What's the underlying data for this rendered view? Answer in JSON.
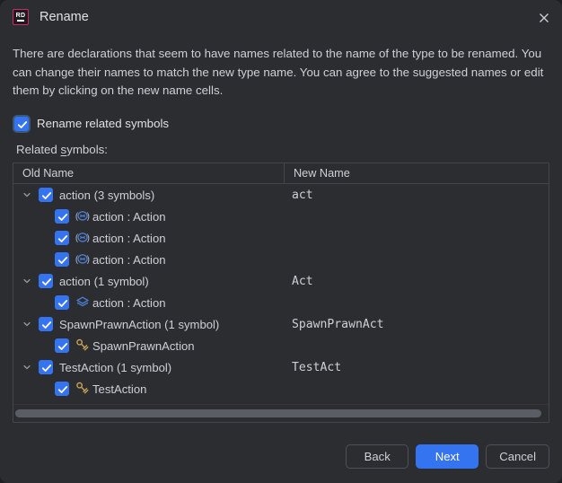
{
  "window": {
    "title": "Rename",
    "app_icon": "rider-rd-icon",
    "close_icon": "close-icon"
  },
  "description": "There are declarations that seem to have names related to the name of the type to be renamed. You can change their names to match the new type name. You can agree to the suggested names or edit them by clicking on the new name cells.",
  "rename_related": {
    "label": "Rename related symbols",
    "checked": true
  },
  "related_symbols_label": {
    "prefix": "Related ",
    "mnemonic": "s",
    "suffix": "ymbols:"
  },
  "table": {
    "columns": [
      "Old Name",
      "New Name"
    ],
    "rows": [
      {
        "level": "parent",
        "expanded": true,
        "checked": true,
        "icon": "none",
        "old_name": "action (3 symbols)",
        "new_name": "act"
      },
      {
        "level": "child",
        "expanded": false,
        "checked": true,
        "icon": "parameter-icon",
        "old_name": "action : Action",
        "new_name": ""
      },
      {
        "level": "child",
        "expanded": false,
        "checked": true,
        "icon": "parameter-icon",
        "old_name": "action : Action",
        "new_name": ""
      },
      {
        "level": "child",
        "expanded": false,
        "checked": true,
        "icon": "parameter-icon",
        "old_name": "action : Action",
        "new_name": ""
      },
      {
        "level": "parent",
        "expanded": true,
        "checked": true,
        "icon": "none",
        "old_name": "action (1 symbol)",
        "new_name": "Act"
      },
      {
        "level": "child",
        "expanded": false,
        "checked": true,
        "icon": "local-variable-icon",
        "old_name": "action : Action",
        "new_name": ""
      },
      {
        "level": "parent",
        "expanded": true,
        "checked": true,
        "icon": "none",
        "old_name": "SpawnPrawnAction (1 symbol)",
        "new_name": "SpawnPrawnAct"
      },
      {
        "level": "child",
        "expanded": false,
        "checked": true,
        "icon": "class-icon",
        "old_name": "SpawnPrawnAction",
        "new_name": ""
      },
      {
        "level": "parent",
        "expanded": true,
        "checked": true,
        "icon": "none",
        "old_name": "TestAction (1 symbol)",
        "new_name": "TestAct"
      },
      {
        "level": "child",
        "expanded": false,
        "checked": true,
        "icon": "class-icon",
        "old_name": "TestAction",
        "new_name": ""
      }
    ]
  },
  "buttons": {
    "back": "Back",
    "next": "Next",
    "cancel": "Cancel"
  },
  "colors": {
    "accent": "#3574f0",
    "dialog_bg": "#2b2d30",
    "text": "#ced0d6",
    "border": "#43454a",
    "logo_border": "#d6246b",
    "class_icon": "#c8a05a",
    "parameter_icon": "#4d7fd6"
  }
}
